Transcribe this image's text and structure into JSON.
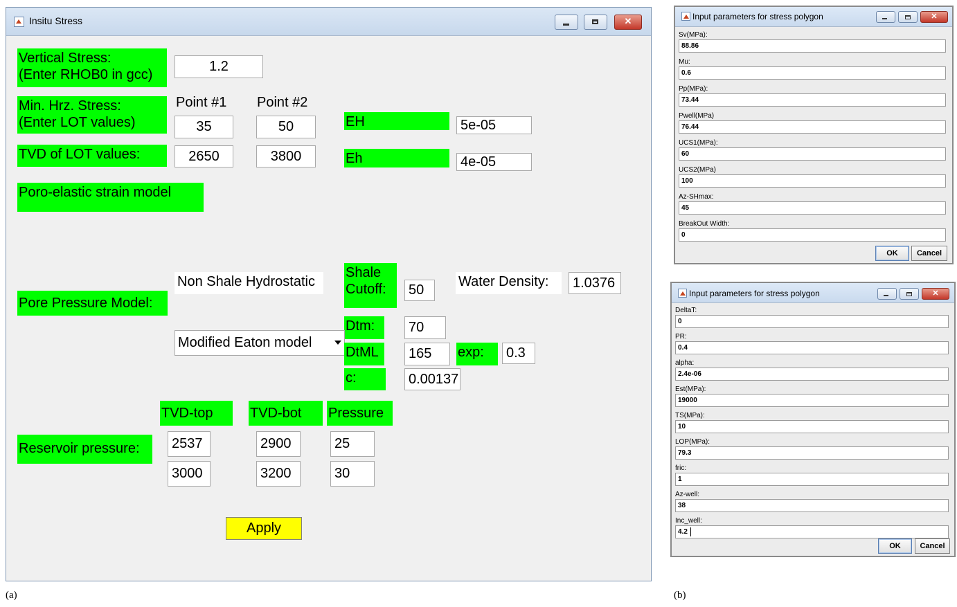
{
  "main_window": {
    "title": "Insitu Stress",
    "vertical_stress_label": "Vertical Stress:\n(Enter RHOB0 in gcc)",
    "vertical_stress_value": "1.2",
    "min_hrz_label": "Min. Hrz. Stress:\n (Enter LOT values)",
    "point1_header": "Point #1",
    "point2_header": "Point #2",
    "lot_point1": "35",
    "lot_point2": "50",
    "tvd_lot_label": "TVD of LOT values:",
    "tvd_point1": "2650",
    "tvd_point2": "3800",
    "eh_upper_label": "EH",
    "eh_upper_value": "5e-05",
    "eh_lower_label": "Eh",
    "eh_lower_value": "4e-05",
    "poro_label": "Poro-elastic strain model",
    "pore_pressure_label": "Pore Pressure Model:",
    "non_shale_text": "Non Shale Hydrostatic",
    "shale_cutoff_label": "Shale\nCutoff:",
    "shale_cutoff_value": "50",
    "water_density_label": "Water Density:",
    "water_density_value": "1.0376",
    "model_selected": "Modified Eaton model",
    "dtm_label": "Dtm:",
    "dtm_value": "70",
    "dtml_label": "DtML",
    "dtml_value": "165",
    "exp_label": "exp:",
    "exp_value": "0.3",
    "c_label": "c:",
    "c_value": "0.00137",
    "tvd_top_header": "TVD-top",
    "tvd_bot_header": "TVD-bot",
    "pressure_header": "Pressure",
    "reservoir_label": "Reservoir pressure:",
    "reservoir_rows": [
      {
        "top": "2537",
        "bot": "2900",
        "pressure": "25"
      },
      {
        "top": "3000",
        "bot": "3200",
        "pressure": "30"
      }
    ],
    "apply_label": "Apply"
  },
  "dialog_1": {
    "title": "Input parameters for stress polygon",
    "fields": [
      {
        "label": "Sv(MPa):",
        "value": "88.86"
      },
      {
        "label": "Mu:",
        "value": "0.6"
      },
      {
        "label": "Pp(MPa):",
        "value": "73.44"
      },
      {
        "label": "Pwell(MPa)",
        "value": "76.44"
      },
      {
        "label": "UCS1(MPa):",
        "value": "60"
      },
      {
        "label": "UCS2(MPa)",
        "value": "100"
      },
      {
        "label": "Az-SHmax:",
        "value": "45"
      },
      {
        "label": "BreakOut Width:",
        "value": "0"
      }
    ],
    "ok_label": "OK",
    "cancel_label": "Cancel"
  },
  "dialog_2": {
    "title": "Input parameters for stress polygon",
    "fields": [
      {
        "label": "DeltaT:",
        "value": "0"
      },
      {
        "label": "PR:",
        "value": "0.4"
      },
      {
        "label": "alpha:",
        "value": "2.4e-06"
      },
      {
        "label": "Est(MPa):",
        "value": "19000"
      },
      {
        "label": "TS(MPa):",
        "value": "10"
      },
      {
        "label": "LOP(MPa):",
        "value": "79.3"
      },
      {
        "label": "fric:",
        "value": "1"
      },
      {
        "label": "Az-well:",
        "value": "38"
      },
      {
        "label": "Inc_well:",
        "value": "4.2"
      }
    ],
    "ok_label": "OK",
    "cancel_label": "Cancel"
  },
  "captions": {
    "a": "(a)",
    "b": "(b)"
  }
}
